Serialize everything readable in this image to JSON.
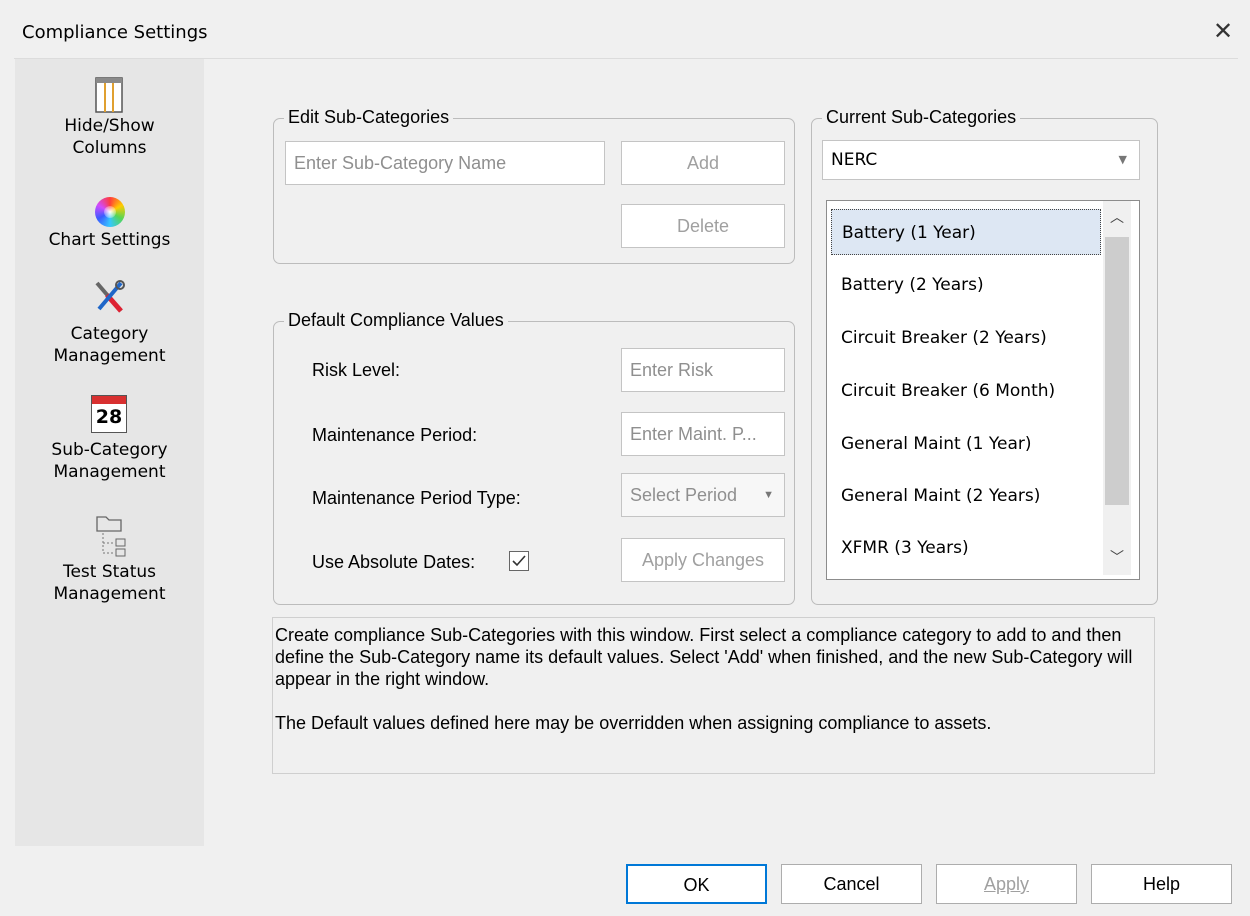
{
  "window": {
    "title": "Compliance Settings",
    "close_glyph": "✕"
  },
  "sidebar": {
    "items": [
      {
        "label_line1": "Hide/Show",
        "label_line2": "Columns",
        "icon": "columns-icon"
      },
      {
        "label_line1": "Chart Settings",
        "label_line2": "",
        "icon": "color-wheel-icon"
      },
      {
        "label_line1": "Category",
        "label_line2": "Management",
        "icon": "tools-icon"
      },
      {
        "label_line1": "Sub-Category",
        "label_line2": "Management",
        "icon": "calendar-icon",
        "icon_text": "28"
      },
      {
        "label_line1": "Test Status",
        "label_line2": "Management",
        "icon": "folder-tree-icon"
      }
    ]
  },
  "edit_subcategories": {
    "legend": "Edit Sub-Categories",
    "name_placeholder": "Enter Sub-Category Name",
    "add_label": "Add",
    "delete_label": "Delete"
  },
  "defaults": {
    "legend": "Default Compliance Values",
    "risk_label": "Risk Level:",
    "risk_placeholder": "Enter Risk",
    "period_label": "Maintenance Period:",
    "period_placeholder": "Enter Maint. P...",
    "period_type_label": "Maintenance Period Type:",
    "period_type_value": "Select Period",
    "absolute_label": "Use Absolute Dates:",
    "absolute_checked": true,
    "apply_changes_label": "Apply Changes"
  },
  "current_subcategories": {
    "legend": "Current Sub-Categories",
    "category_value": "NERC",
    "items": [
      "Battery (1 Year)",
      "Battery (2 Years)",
      "Circuit Breaker (2 Years)",
      "Circuit Breaker (6 Month)",
      "General Maint (1 Year)",
      "General Maint (2 Years)",
      "XFMR (3 Years)"
    ],
    "selected_index": 0
  },
  "help_text": {
    "paragraph1": "Create compliance Sub-Categories with this window.  First select a compliance category to add to and then define the Sub-Category name its default values. Select 'Add' when finished, and the new Sub-Category will appear in the right window.",
    "paragraph2": "The Default values defined here may be overridden when assigning compliance to assets."
  },
  "footer": {
    "ok_label": "OK",
    "cancel_label": "Cancel",
    "apply_label": "Apply",
    "help_label": "Help"
  },
  "colors": {
    "background": "#f0f0f0",
    "sidebar": "#e6e6e6",
    "selection": "#dde7f3",
    "focus_border": "#0078d7"
  }
}
